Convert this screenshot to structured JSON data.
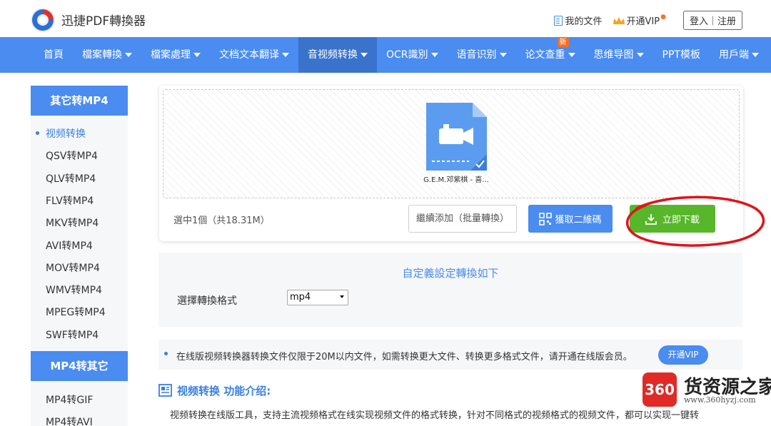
{
  "header": {
    "brand": "迅捷PDF轉換器",
    "my_files": "我的文件",
    "vip": "开通VIP",
    "login": "登入｜注册"
  },
  "nav": {
    "items": [
      {
        "label": "首頁",
        "caret": false
      },
      {
        "label": "檔案轉換",
        "caret": true
      },
      {
        "label": "檔案處理",
        "caret": true
      },
      {
        "label": "文档文本翻译",
        "caret": true
      },
      {
        "label": "音视频转换",
        "caret": true,
        "active": true
      },
      {
        "label": "OCR識別",
        "caret": true
      },
      {
        "label": "语音识别",
        "caret": true
      },
      {
        "label": "论文查重",
        "caret": true,
        "badge": "新"
      },
      {
        "label": "思维导图",
        "caret": true
      },
      {
        "label": "PPT模板",
        "caret": false
      },
      {
        "label": "用戶端",
        "caret": true
      }
    ]
  },
  "sidebar": {
    "group1_title": "其它转MP4",
    "group1_items": [
      "视频转换",
      "QSV转MP4",
      "QLV转MP4",
      "FLV转MP4",
      "MKV转MP4",
      "AVI转MP4",
      "MOV转MP4",
      "WMV转MP4",
      "MPEG转MP4",
      "SWF转MP4"
    ],
    "group2_title": "MP4转其它",
    "group2_items": [
      "MP4转GIF",
      "MP4转AVI"
    ]
  },
  "upload": {
    "file_name": "G.E.M.邓紫棋 - 喜...",
    "selected_info": "選中1個（共18.31M）",
    "add_button": "繼續添加（批量轉換）",
    "qr_button": "獲取二維碼",
    "download_button": "立即下載"
  },
  "settings": {
    "title": "自定義設定轉換如下",
    "format_label": "選擇轉換格式",
    "format_value": "mp4"
  },
  "notice": {
    "text": "在线版视频转换器转换文件仅限于20M以内文件，如需转换更大文件、转换更多格式文件，请开通在线版会员。",
    "vip_button": "开通VIP"
  },
  "intro": {
    "title": "视频转换 功能介绍:",
    "text": "视频转换在线版工具，支持主流视频格式在线实现视频文件的格式转换，针对不同格式的视频格式的视频文件，都可以实现一键转"
  },
  "watermark": {
    "badge": "360",
    "name": "货资源之家",
    "url": "www.360hyzj.com"
  },
  "colors": {
    "primary": "#4a8cf0",
    "nav_active": "#3a73cc",
    "download": "#58b62b",
    "annotation": "#e0131a"
  }
}
